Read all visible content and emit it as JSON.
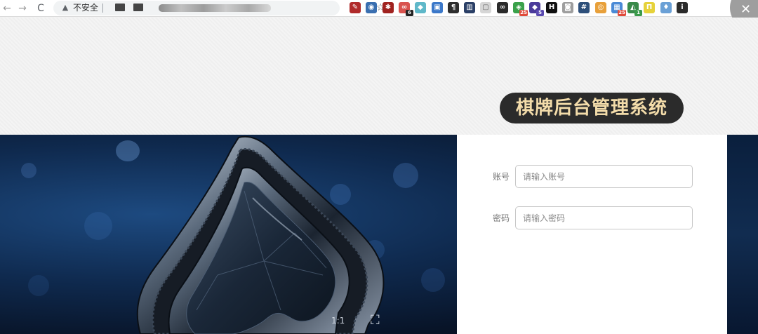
{
  "browser": {
    "back_icon": "←",
    "forward_icon": "→",
    "reload_icon": "C",
    "warn_icon": "▲",
    "insecure_label": "不安全",
    "star_icon": "☆",
    "close_icon": "✕",
    "extensions": [
      {
        "name": "red-ext-icon",
        "color": "#b02a2a",
        "glyph": "✎",
        "badge": ""
      },
      {
        "name": "target-ext-icon",
        "color": "#3a6fb0",
        "glyph": "◉",
        "badge": ""
      },
      {
        "name": "bug-ext-icon",
        "color": "#a0221f",
        "glyph": "✱",
        "badge": ""
      },
      {
        "name": "link-ext-icon",
        "color": "#d9534f",
        "glyph": "∞",
        "badge": "6"
      },
      {
        "name": "gem-ext-icon",
        "color": "#5fb8c9",
        "glyph": "◆",
        "badge": ""
      },
      {
        "name": "save-ext-icon",
        "color": "#3b78c9",
        "glyph": "▣",
        "badge": ""
      },
      {
        "name": "paragraph-ext-icon",
        "color": "#2d2d2d",
        "glyph": "¶",
        "badge": ""
      },
      {
        "name": "chart-ext-icon",
        "color": "#2a3f66",
        "glyph": "▥",
        "badge": ""
      },
      {
        "name": "page-ext-icon",
        "color": "#d6d6d6",
        "glyph": "▢",
        "badge": ""
      },
      {
        "name": "glasses-ext-icon",
        "color": "#2b2b2b",
        "glyph": "∞",
        "badge": ""
      },
      {
        "name": "green-ext-icon",
        "color": "#3aa14a",
        "glyph": "◈",
        "badge": "25"
      },
      {
        "name": "cube-ext-icon",
        "color": "#4a3a9a",
        "glyph": "◆",
        "badge": "5"
      },
      {
        "name": "h-ext-icon",
        "color": "#111111",
        "glyph": "H",
        "badge": ""
      },
      {
        "name": "camera-ext-icon",
        "color": "#9e9e9e",
        "glyph": "◙",
        "badge": ""
      },
      {
        "name": "hash-ext-icon",
        "color": "#2d4f7a",
        "glyph": "#",
        "badge": ""
      },
      {
        "name": "chrome-ext-icon",
        "color": "#e8a03a",
        "glyph": "◎",
        "badge": ""
      },
      {
        "name": "grid-ext-icon",
        "color": "#4a8ad6",
        "glyph": "▦",
        "badge": "25"
      },
      {
        "name": "shield-ext-icon",
        "color": "#3a8a4a",
        "glyph": "◭",
        "badge": "1"
      },
      {
        "name": "bracket-ext-icon",
        "color": "#e6d23a",
        "glyph": "Π",
        "badge": ""
      },
      {
        "name": "pin-ext-icon",
        "color": "#6aa0d6",
        "glyph": "♦",
        "badge": ""
      },
      {
        "name": "info-ext-icon",
        "color": "#2b2b2b",
        "glyph": "i",
        "badge": ""
      }
    ]
  },
  "page": {
    "title": "棋牌后台管理系统"
  },
  "login": {
    "account_label": "账号",
    "account_placeholder": "请输入账号",
    "password_label": "密码",
    "password_placeholder": "请输入密码"
  },
  "viewer": {
    "ratio_label": "1:1",
    "fullscreen_icon": "⛶"
  },
  "colors": {
    "title_text": "#f3dcaa",
    "title_bg": "#2b2b2b"
  }
}
